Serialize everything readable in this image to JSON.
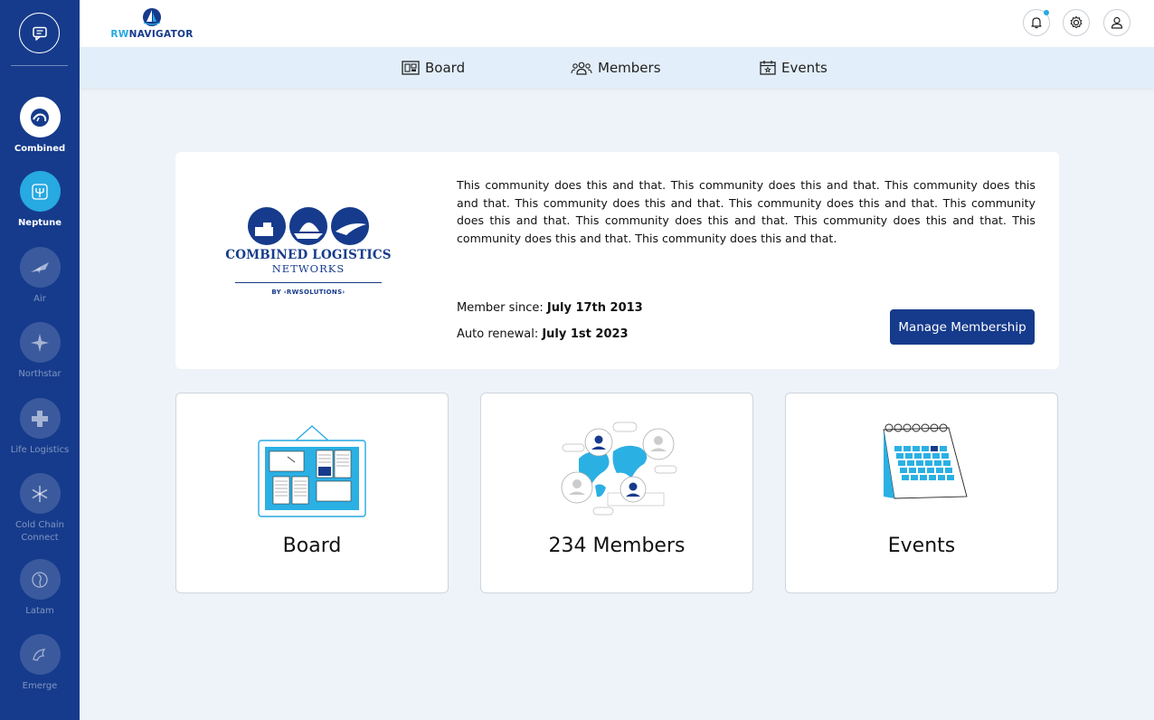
{
  "app": {
    "brand_rw": "RW",
    "brand_nav": "NAVIGATOR"
  },
  "sidebar": {
    "items": [
      {
        "label": "Combined",
        "icon": "combined-logo-icon"
      },
      {
        "label": "Neptune",
        "icon": "trident-icon"
      },
      {
        "label": "Air",
        "icon": "plane-icon"
      },
      {
        "label": "Northstar",
        "icon": "star-icon"
      },
      {
        "label": "Life Logistics",
        "icon": "cross-icon"
      },
      {
        "label": "Cold Chain Connect",
        "icon": "snowflake-icon"
      },
      {
        "label": "Latam",
        "icon": "globe-icon"
      },
      {
        "label": "Emerge",
        "icon": "emerge-icon"
      }
    ]
  },
  "tabs": [
    {
      "label": "Board",
      "icon": "board-icon"
    },
    {
      "label": "Members",
      "icon": "members-icon"
    },
    {
      "label": "Events",
      "icon": "calendar-icon"
    }
  ],
  "community": {
    "logo_title": "COMBINED LOGISTICS",
    "logo_subtitle": "NETWORKS",
    "logo_by": "BY ‹RWSOLUTIONS›",
    "description": "This community does this and that. This community does this and that. This community does this and that. This community does this and that. This community does this and that. This community does this and that. This community does this and that. This community does this and that. This community does this and that. This community does this and that.",
    "member_since_label": "Member since:",
    "member_since_value": "July 17th 2013",
    "auto_renewal_label": "Auto renewal:",
    "auto_renewal_value": "July 1st 2023",
    "manage_button": "Manage Membership"
  },
  "cards": [
    {
      "label": "Board",
      "icon": "board-illustration"
    },
    {
      "label": "234 Members",
      "icon": "members-map-illustration"
    },
    {
      "label": "Events",
      "icon": "calendar-illustration"
    }
  ],
  "colors": {
    "sidebar": "#163b8c",
    "accent": "#27a9e1",
    "tabbar": "#e2eef9",
    "page_bg": "#eef3f9",
    "primary_button": "#163b8c"
  }
}
